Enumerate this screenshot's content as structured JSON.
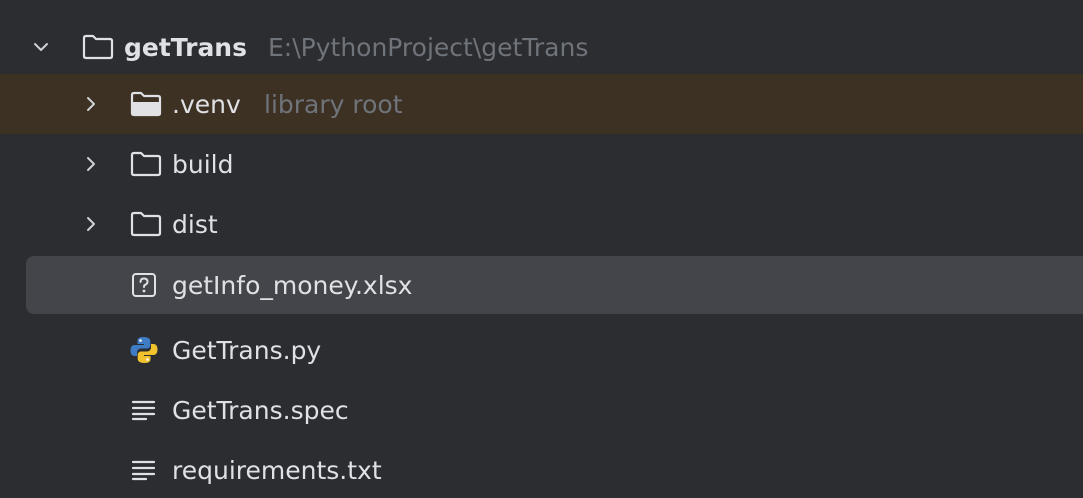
{
  "tree": {
    "root": {
      "name": "getTrans",
      "path": "E:\\PythonProject\\getTrans",
      "expanded": true,
      "icon": "folder-icon"
    },
    "items": [
      {
        "name": ".venv",
        "hint": "library root",
        "type": "folder",
        "icon": "folder-icon",
        "expanded": false,
        "highlighted": true
      },
      {
        "name": "build",
        "type": "folder",
        "icon": "folder-icon",
        "expanded": false
      },
      {
        "name": "dist",
        "type": "folder",
        "icon": "folder-icon",
        "expanded": false
      },
      {
        "name": "getInfo_money.xlsx",
        "type": "file",
        "icon": "unknown-file-icon",
        "selected": true
      },
      {
        "name": "GetTrans.py",
        "type": "file",
        "icon": "python-file-icon"
      },
      {
        "name": "GetTrans.spec",
        "type": "file",
        "icon": "text-file-icon"
      },
      {
        "name": "requirements.txt",
        "type": "file",
        "icon": "text-file-icon"
      }
    ]
  },
  "colors": {
    "background": "#2b2d30",
    "library_root_highlight": "#3d3124",
    "selection": "#43454a",
    "text": "#dfe1e5",
    "hint_text": "#6f737a",
    "python_blue": "#3f7cc4",
    "python_yellow": "#f2c22e"
  }
}
